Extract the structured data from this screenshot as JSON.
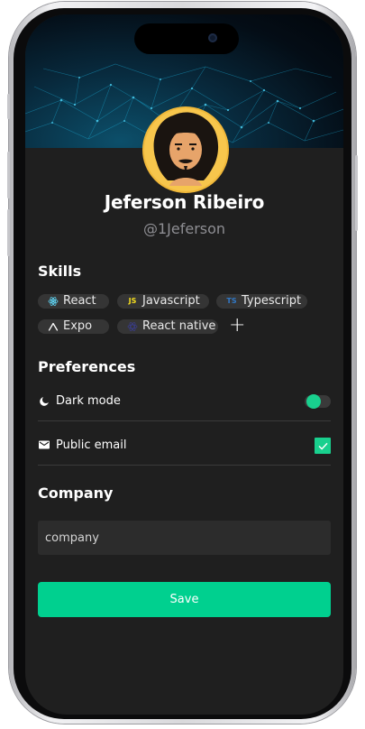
{
  "profile": {
    "name": "Jeferson Ribeiro",
    "handle": "@1Jeferson"
  },
  "skills": {
    "title": "Skills",
    "items": [
      {
        "label": "React",
        "icon": "react-icon"
      },
      {
        "label": "Javascript",
        "icon": "javascript-icon",
        "badge": "JS"
      },
      {
        "label": "Typescript",
        "icon": "typescript-icon",
        "badge": "TS"
      },
      {
        "label": "Expo",
        "icon": "expo-icon"
      },
      {
        "label": "React native",
        "icon": "react-native-icon"
      }
    ],
    "add_label": "+"
  },
  "preferences": {
    "title": "Preferences",
    "dark_mode": {
      "label": "Dark mode",
      "icon": "moon-icon",
      "enabled": true
    },
    "public_email": {
      "label": "Public email",
      "icon": "mail-icon",
      "checked": true
    }
  },
  "company": {
    "title": "Company",
    "placeholder": "company"
  },
  "actions": {
    "save_label": "Save"
  },
  "colors": {
    "accent": "#00d08f",
    "background": "#1f1f1f",
    "chip": "#353535"
  }
}
